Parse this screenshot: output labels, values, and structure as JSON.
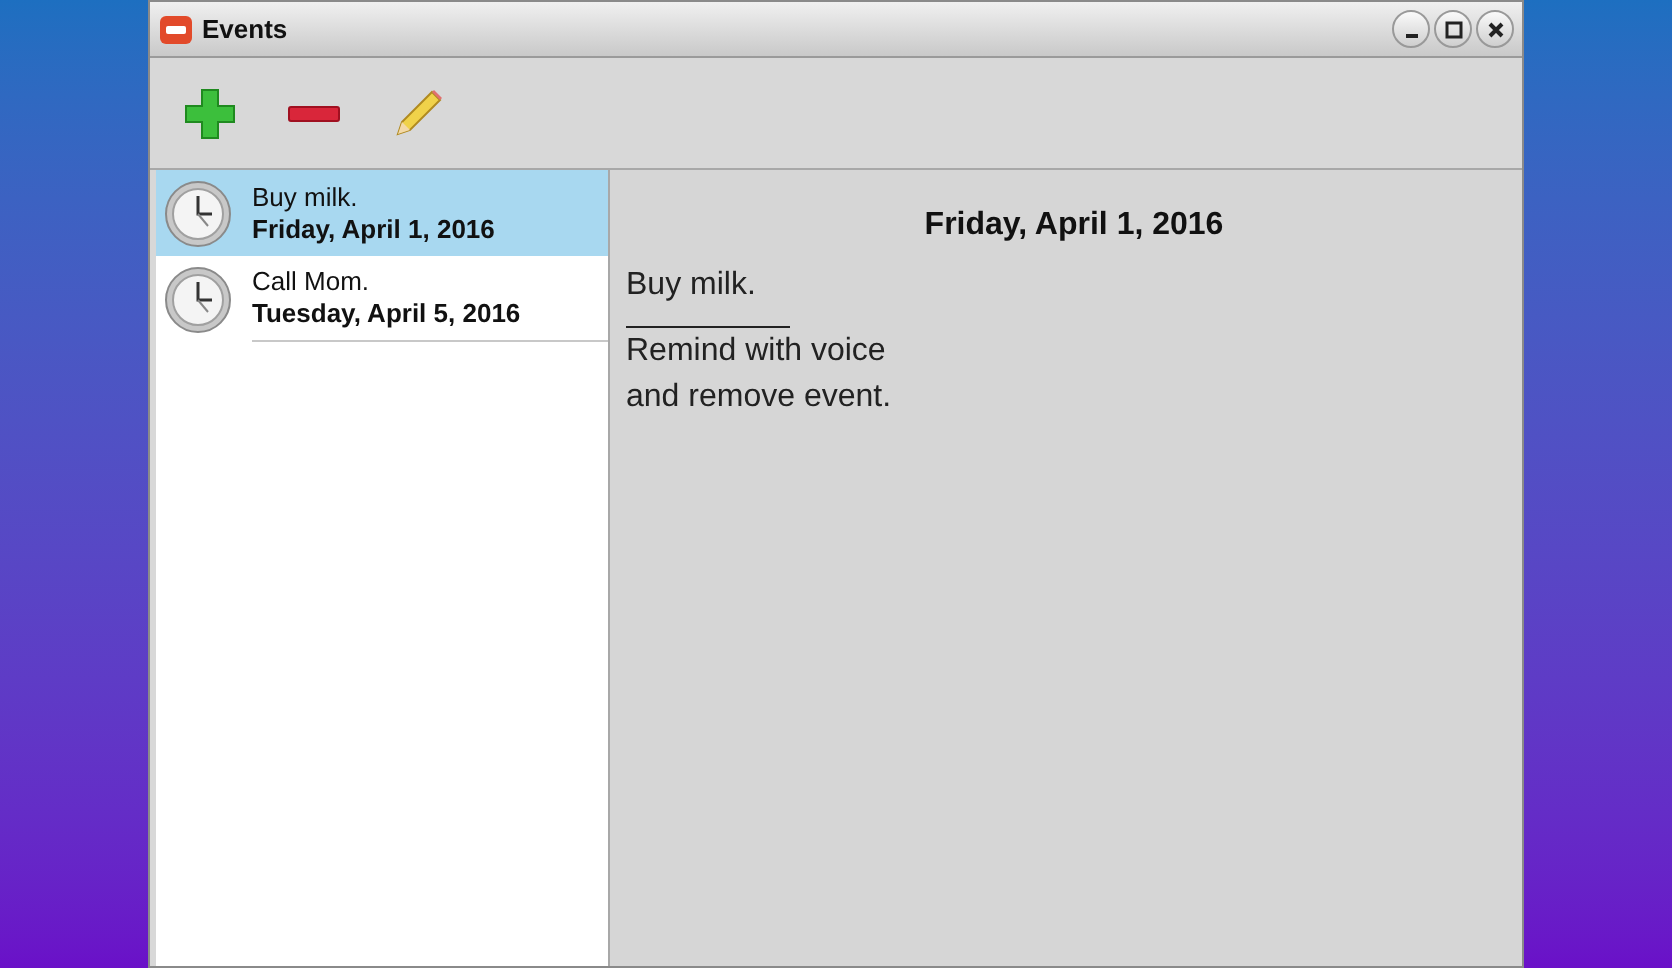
{
  "window": {
    "title": "Events"
  },
  "events": [
    {
      "title": "Buy milk.",
      "date": "Friday, April 1, 2016",
      "selected": true
    },
    {
      "title": "Call Mom.",
      "date": "Tuesday, April 5, 2016",
      "selected": false
    }
  ],
  "detail": {
    "date": "Friday, April 1, 2016",
    "title": "Buy milk.",
    "note_lines": [
      "Remind with voice",
      "and remove event."
    ]
  }
}
